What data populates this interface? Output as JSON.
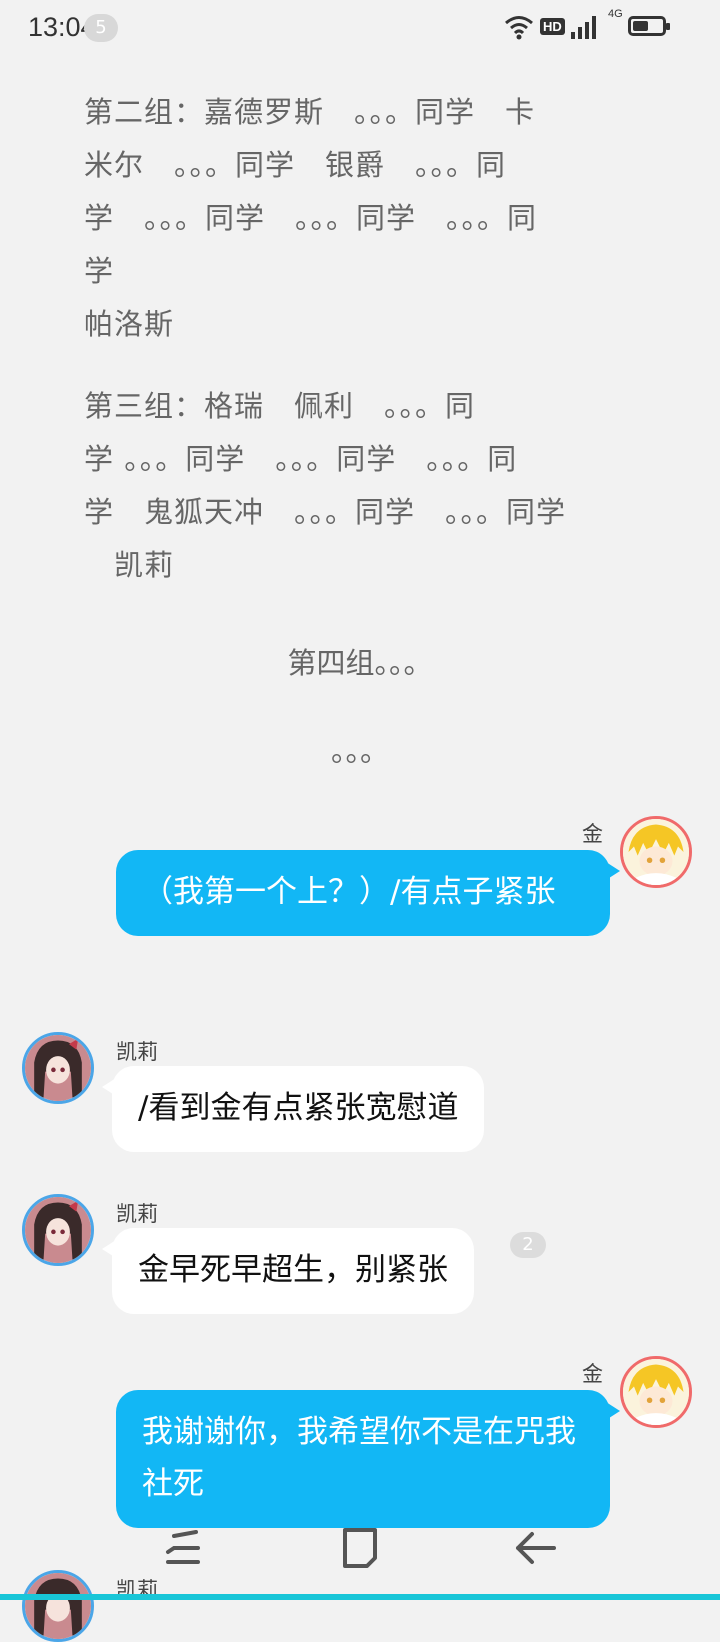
{
  "status_bar": {
    "time": "13:04",
    "notification_count": "5",
    "hd_label": "HD",
    "network_label": "4G",
    "battery_level": 0.55
  },
  "narration": {
    "group2": [
      "第二组：嘉德罗斯　。。。同学　卡",
      "米尔　。。。同学　银爵　。。。同",
      "学　。。。同学　。。。同学　。。。同",
      "学",
      "帕洛斯"
    ],
    "group3": [
      "第三组：格瑞　佩利　。。。同",
      "学 。。。同学　。。。同学　。。。同",
      "学　鬼狐天冲　。。。同学　。。。同学",
      "　凯莉"
    ],
    "group4": "第四组。。。",
    "ellipsis": "。。。"
  },
  "messages": [
    {
      "sender": "金",
      "text": "（我第一个上？）/有点子紧张"
    },
    {
      "sender": "凯莉",
      "text": "/看到金有点紧张宽慰道"
    },
    {
      "sender": "凯莉",
      "text": "金早死早超生，别紧张",
      "badge": "2"
    },
    {
      "sender": "金",
      "text": "我谢谢你，我希望你不是在咒我社死"
    },
    {
      "sender": "凯莉"
    }
  ],
  "nav": {
    "icons": [
      "menu-icon",
      "home-icon",
      "back-icon"
    ]
  },
  "colors": {
    "self_bubble": "#12b7f5",
    "other_bubble": "#ffffff",
    "background": "#f2f2f2",
    "narration_text": "#666666"
  }
}
